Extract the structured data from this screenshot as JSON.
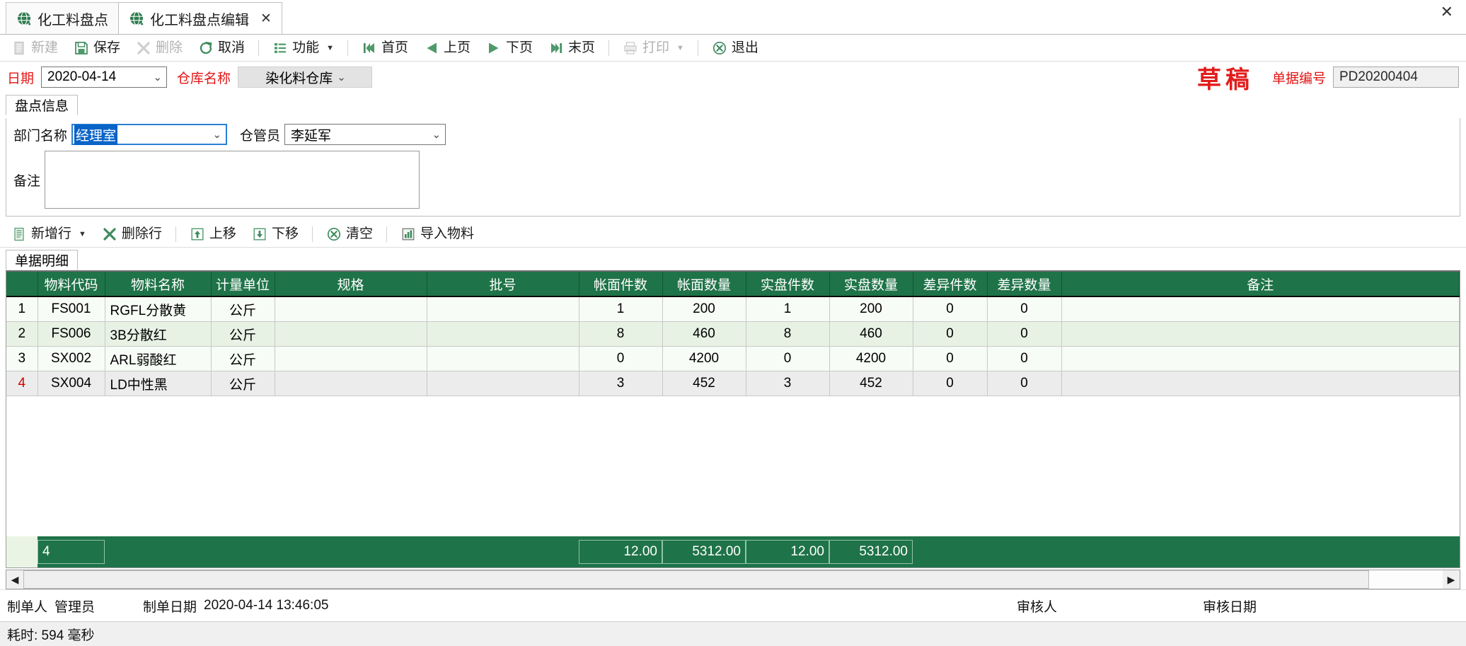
{
  "window": {
    "close_label": "✕"
  },
  "tabs": [
    {
      "label": "化工料盘点",
      "icon": "globe-icon",
      "active": false,
      "closable": false
    },
    {
      "label": "化工料盘点编辑",
      "icon": "globe-icon",
      "active": true,
      "closable": true,
      "close_label": "✕"
    }
  ],
  "toolbar": {
    "buttons": [
      {
        "label": "新建",
        "icon": "new-document-icon",
        "disabled": true
      },
      {
        "label": "保存",
        "icon": "save-icon",
        "disabled": false
      },
      {
        "label": "删除",
        "icon": "delete-x-icon",
        "disabled": true
      },
      {
        "label": "取消",
        "icon": "refresh-cancel-icon",
        "disabled": false
      },
      {
        "label": "功能",
        "icon": "list-menu-icon",
        "disabled": false,
        "caret": "▼"
      },
      {
        "label": "首页",
        "icon": "first-page-icon",
        "disabled": false
      },
      {
        "label": "上页",
        "icon": "prev-page-icon",
        "disabled": false
      },
      {
        "label": "下页",
        "icon": "next-page-icon",
        "disabled": false
      },
      {
        "label": "末页",
        "icon": "last-page-icon",
        "disabled": false
      },
      {
        "label": "打印",
        "icon": "printer-icon",
        "disabled": true,
        "caret": "▼"
      },
      {
        "label": "退出",
        "icon": "exit-circle-icon",
        "disabled": false
      }
    ]
  },
  "header": {
    "date_label": "日期",
    "date_value": "2020-04-14",
    "warehouse_label": "仓库名称",
    "warehouse_value": "染化料仓库",
    "status_stamp": "草稿",
    "docno_label": "单据编号",
    "docno_value": "PD20200404",
    "chevron": "⌄"
  },
  "info_panel": {
    "tab_label": "盘点信息",
    "dept_label": "部门名称",
    "dept_value": "经理室",
    "keeper_label": "仓管员",
    "keeper_value": "李延军",
    "note_label": "备注",
    "note_value": ""
  },
  "row_toolbar": {
    "buttons": [
      {
        "label": "新增行",
        "icon": "add-row-icon",
        "disabled": false,
        "caret": "▼"
      },
      {
        "label": "删除行",
        "icon": "delete-row-x-icon",
        "disabled": false
      },
      {
        "label": "上移",
        "icon": "move-up-icon",
        "disabled": false
      },
      {
        "label": "下移",
        "icon": "move-down-icon",
        "disabled": false
      },
      {
        "label": "清空",
        "icon": "clear-circle-icon",
        "disabled": false
      },
      {
        "label": "导入物料",
        "icon": "import-material-icon",
        "disabled": false
      }
    ]
  },
  "detail": {
    "tab_label": "单据明细",
    "columns": [
      "",
      "物料代码",
      "物料名称",
      "计量单位",
      "规格",
      "批号",
      "帐面件数",
      "帐面数量",
      "实盘件数",
      "实盘数量",
      "差异件数",
      "差异数量",
      "备注"
    ],
    "rows": [
      {
        "no": "1",
        "code": "FS001",
        "name": "RGFL分散黄",
        "unit": "公斤",
        "spec": "",
        "batch": "",
        "book_pcs": "1",
        "book_qty": "200",
        "actual_pcs": "1",
        "actual_qty": "200",
        "diff_pcs": "0",
        "diff_qty": "0",
        "remark": ""
      },
      {
        "no": "2",
        "code": "FS006",
        "name": "3B分散红",
        "unit": "公斤",
        "spec": "",
        "batch": "",
        "book_pcs": "8",
        "book_qty": "460",
        "actual_pcs": "8",
        "actual_qty": "460",
        "diff_pcs": "0",
        "diff_qty": "0",
        "remark": ""
      },
      {
        "no": "3",
        "code": "SX002",
        "name": "ARL弱酸红",
        "unit": "公斤",
        "spec": "",
        "batch": "",
        "book_pcs": "0",
        "book_qty": "4200",
        "actual_pcs": "0",
        "actual_qty": "4200",
        "diff_pcs": "0",
        "diff_qty": "0",
        "remark": ""
      },
      {
        "no": "4",
        "code": "SX004",
        "name": "LD中性黑",
        "unit": "公斤",
        "spec": "",
        "batch": "",
        "book_pcs": "3",
        "book_qty": "452",
        "actual_pcs": "3",
        "actual_qty": "452",
        "diff_pcs": "0",
        "diff_qty": "0",
        "remark": ""
      }
    ],
    "summary": {
      "count": "4",
      "book_pcs_total": "12.00",
      "book_qty_total": "5312.00",
      "actual_pcs_total": "12.00",
      "actual_qty_total": "5312.00"
    }
  },
  "scrollbar": {
    "left_arrow": "◀",
    "right_arrow": "▶"
  },
  "footer": {
    "creator_label": "制单人",
    "creator_value": "管理员",
    "create_date_label": "制单日期",
    "create_date_value": "2020-04-14 13:46:05",
    "auditor_label": "审核人",
    "auditor_value": "",
    "audit_date_label": "审核日期",
    "audit_date_value": ""
  },
  "statusbar": {
    "text": "耗时: 594 毫秒"
  }
}
